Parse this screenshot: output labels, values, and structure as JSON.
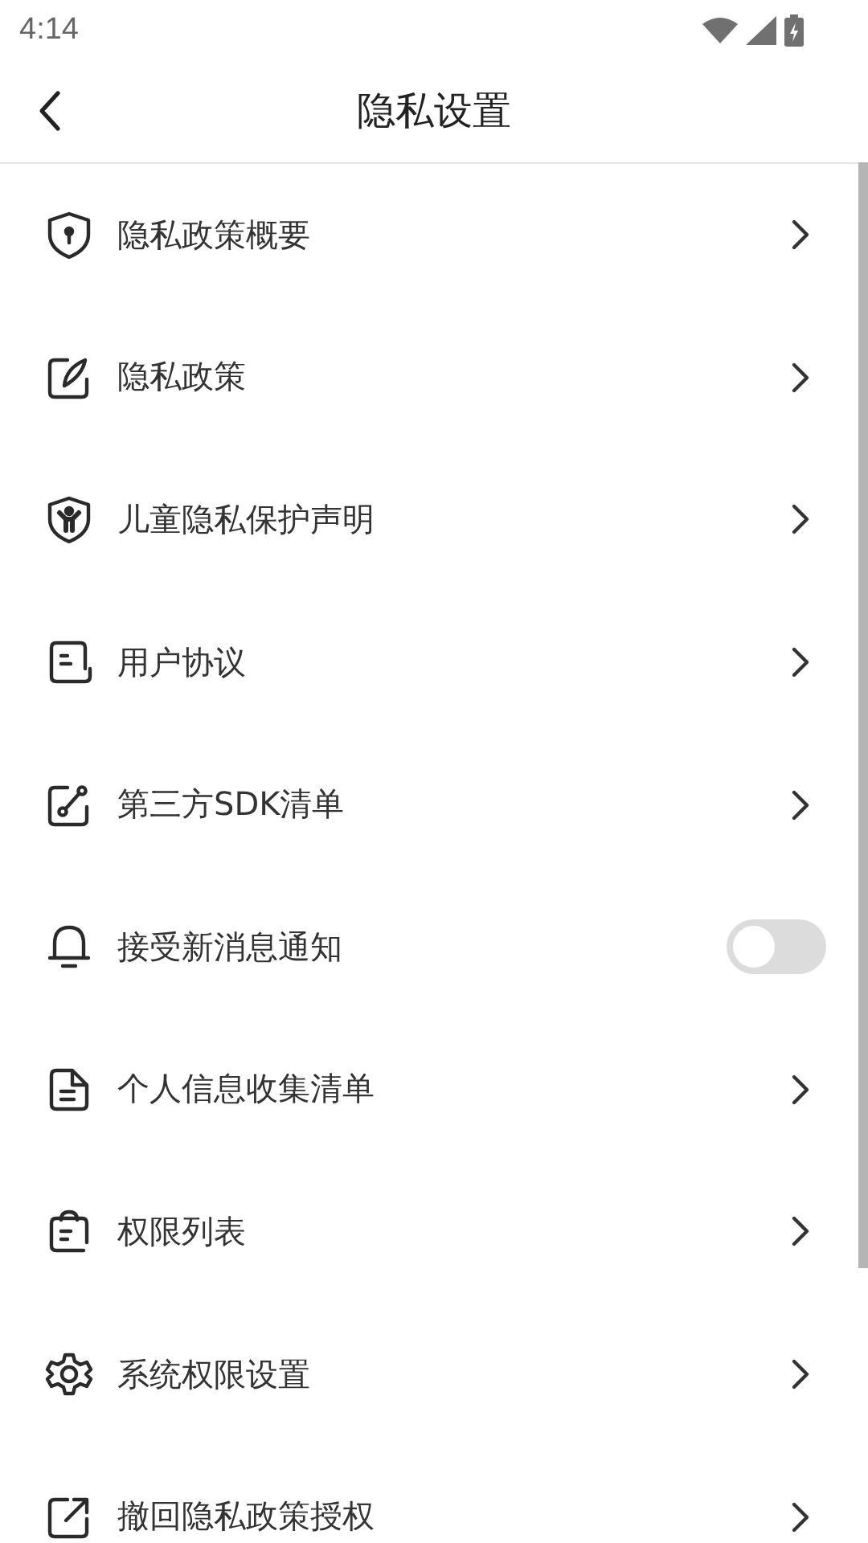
{
  "status_bar": {
    "time": "4:14"
  },
  "header": {
    "title": "隐私设置"
  },
  "items": [
    {
      "kind": "link",
      "label": "隐私政策概要"
    },
    {
      "kind": "link",
      "label": "隐私政策"
    },
    {
      "kind": "link",
      "label": "儿童隐私保护声明"
    },
    {
      "kind": "link",
      "label": "用户协议"
    },
    {
      "kind": "link",
      "label": "第三方SDK清单"
    },
    {
      "kind": "toggle",
      "label": "接受新消息通知",
      "on": false
    },
    {
      "kind": "link",
      "label": "个人信息收集清单"
    },
    {
      "kind": "link",
      "label": "权限列表"
    },
    {
      "kind": "link",
      "label": "系统权限设置"
    },
    {
      "kind": "link",
      "label": "撤回隐私政策授权"
    }
  ]
}
